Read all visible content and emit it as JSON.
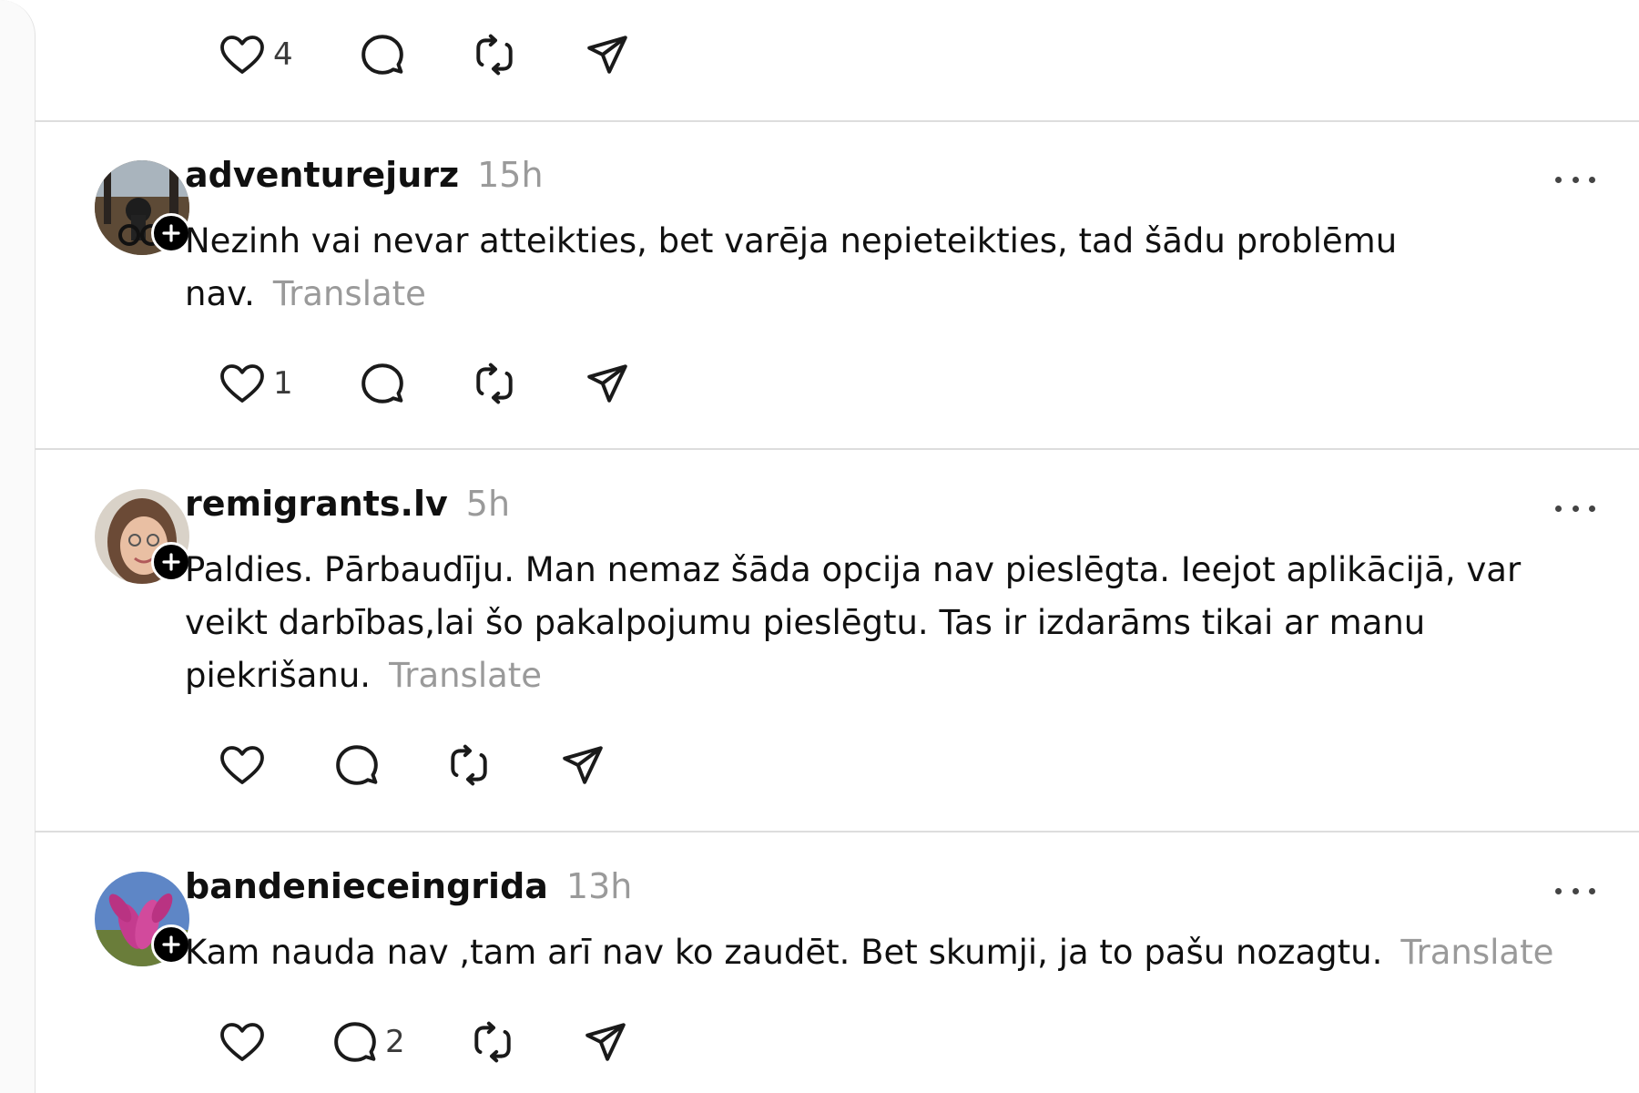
{
  "top_post": {
    "likes": "4"
  },
  "posts": [
    {
      "username": "adventurejurz",
      "time": "15h",
      "text": "Nezinh vai nevar atteikties, bet varēja nepieteikties, tad šādu problēmu nav.",
      "translate": "Translate",
      "likes": "1",
      "replies": ""
    },
    {
      "username": "remigrants.lv",
      "time": "5h",
      "text": "Paldies. Pārbaudīju. Man nemaz šāda opcija nav pieslēgta. Ieejot aplikācijā, var veikt darbības,lai šo pakalpojumu pieslēgtu. Tas ir izdarāms tikai ar manu piekrišanu.",
      "translate": "Translate",
      "likes": "",
      "replies": ""
    },
    {
      "username": "bandenieceingrida",
      "time": "13h",
      "text": "Kam nauda nav ,tam arī nav ko zaudēt. Bet skumji, ja to pašu nozagtu.",
      "translate": "Translate",
      "likes": "",
      "replies": "2"
    }
  ],
  "icons": {
    "like": "heart-icon",
    "reply": "comment-icon",
    "repost": "repost-icon",
    "share": "send-icon",
    "more": "more-dots-icon",
    "follow": "plus-icon"
  },
  "colors": {
    "text": "#101010",
    "muted": "#9a9a9a",
    "divider": "#dddddd"
  }
}
